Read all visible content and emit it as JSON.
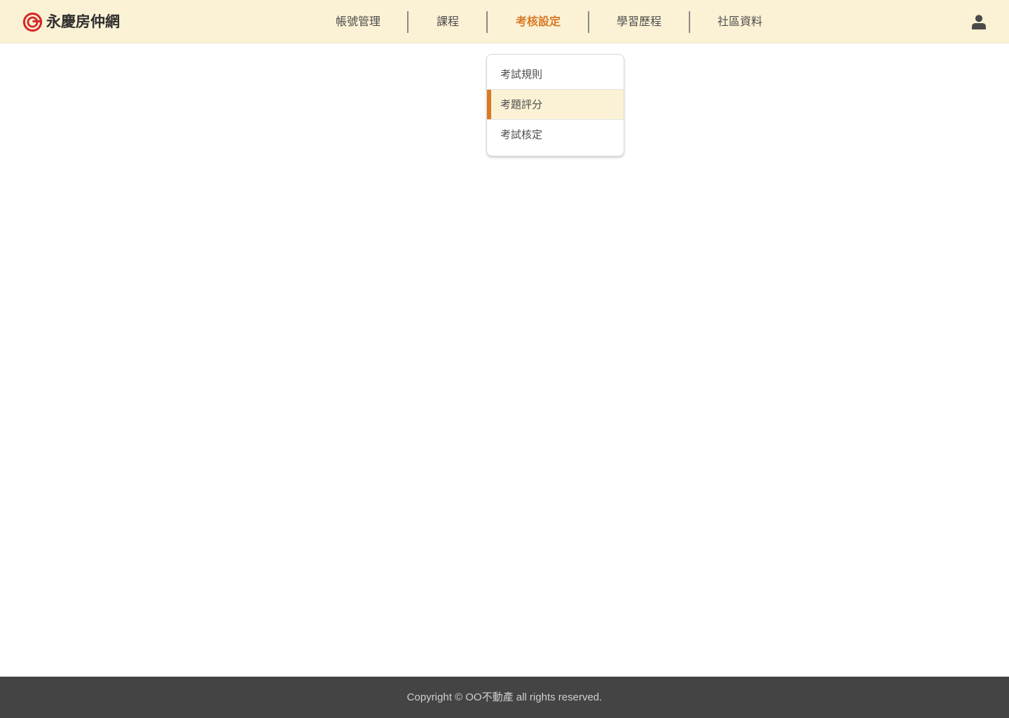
{
  "brand": {
    "name": "永慶房仲網",
    "logo_color": "#d42a2a"
  },
  "nav": {
    "items": [
      {
        "label": "帳號管理",
        "active": false
      },
      {
        "label": "課程",
        "active": false
      },
      {
        "label": "考核設定",
        "active": true
      },
      {
        "label": "學習歷程",
        "active": false
      },
      {
        "label": "社區資料",
        "active": false
      }
    ],
    "accent_color": "#d97a25"
  },
  "user_menu": {
    "icon": "user-icon"
  },
  "dropdown": {
    "items": [
      {
        "label": "考試規則",
        "selected": false
      },
      {
        "label": "考題評分",
        "selected": true
      },
      {
        "label": "考試核定",
        "selected": false
      }
    ]
  },
  "footer": {
    "copyright": "Copyright © OO不動產 all rights reserved."
  },
  "colors": {
    "header_bg": "#fbf1d5",
    "footer_bg": "#444444"
  }
}
